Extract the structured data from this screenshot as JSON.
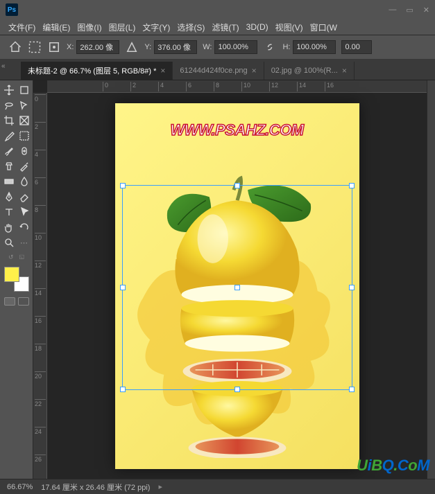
{
  "window": {
    "logo": "Ps",
    "controls": {
      "min": "—",
      "max": "▭",
      "close": "✕"
    }
  },
  "menu": [
    "文件(F)",
    "编辑(E)",
    "图像(I)",
    "图层(L)",
    "文字(Y)",
    "选择(S)",
    "滤镜(T)",
    "3D(D)",
    "视图(V)",
    "窗口(W"
  ],
  "optionsbar": {
    "x_label": "X:",
    "x_value": "262.00 像",
    "y_label": "Y:",
    "y_value": "376.00 像",
    "w_label": "W:",
    "w_value": "100.00%",
    "h_label": "H:",
    "h_value": "100.00%",
    "rot_value": "0.00"
  },
  "tabs": [
    {
      "label": "未标题-2 @ 66.7% (图层 5, RGB/8#) *",
      "active": true
    },
    {
      "label": "61244d424f0ce.png",
      "active": false
    },
    {
      "label": "02.jpg @ 100%(R...",
      "active": false
    }
  ],
  "ruler_h": [
    "0",
    "2",
    "4",
    "6",
    "8",
    "10",
    "12",
    "14",
    "16"
  ],
  "ruler_v": [
    "0",
    "2",
    "4",
    "6",
    "8",
    "10",
    "12",
    "14",
    "16",
    "18",
    "20",
    "22",
    "24",
    "26"
  ],
  "canvas": {
    "watermark": "WWW.PSAHZ.COM"
  },
  "statusbar": {
    "zoom": "66.67%",
    "docinfo": "17.64 厘米 x 26.46 厘米 (72 ppi)"
  },
  "brand": "UiBQ.CoM",
  "tools": {
    "move": "move",
    "selection": "selection",
    "lasso": "lasso",
    "crop": "crop",
    "marquee": "marquee",
    "polygon": "polygon",
    "eyedropper": "eyedropper",
    "patch": "patch",
    "brush": "brush",
    "eraser": "eraser",
    "clone": "clone",
    "history": "history",
    "gradient": "gradient",
    "blur": "blur",
    "pen": "pen",
    "shape": "shape",
    "type": "type",
    "path": "path",
    "hand": "hand",
    "rotate": "rotate",
    "zoom": "zoom",
    "edit": "edit"
  }
}
